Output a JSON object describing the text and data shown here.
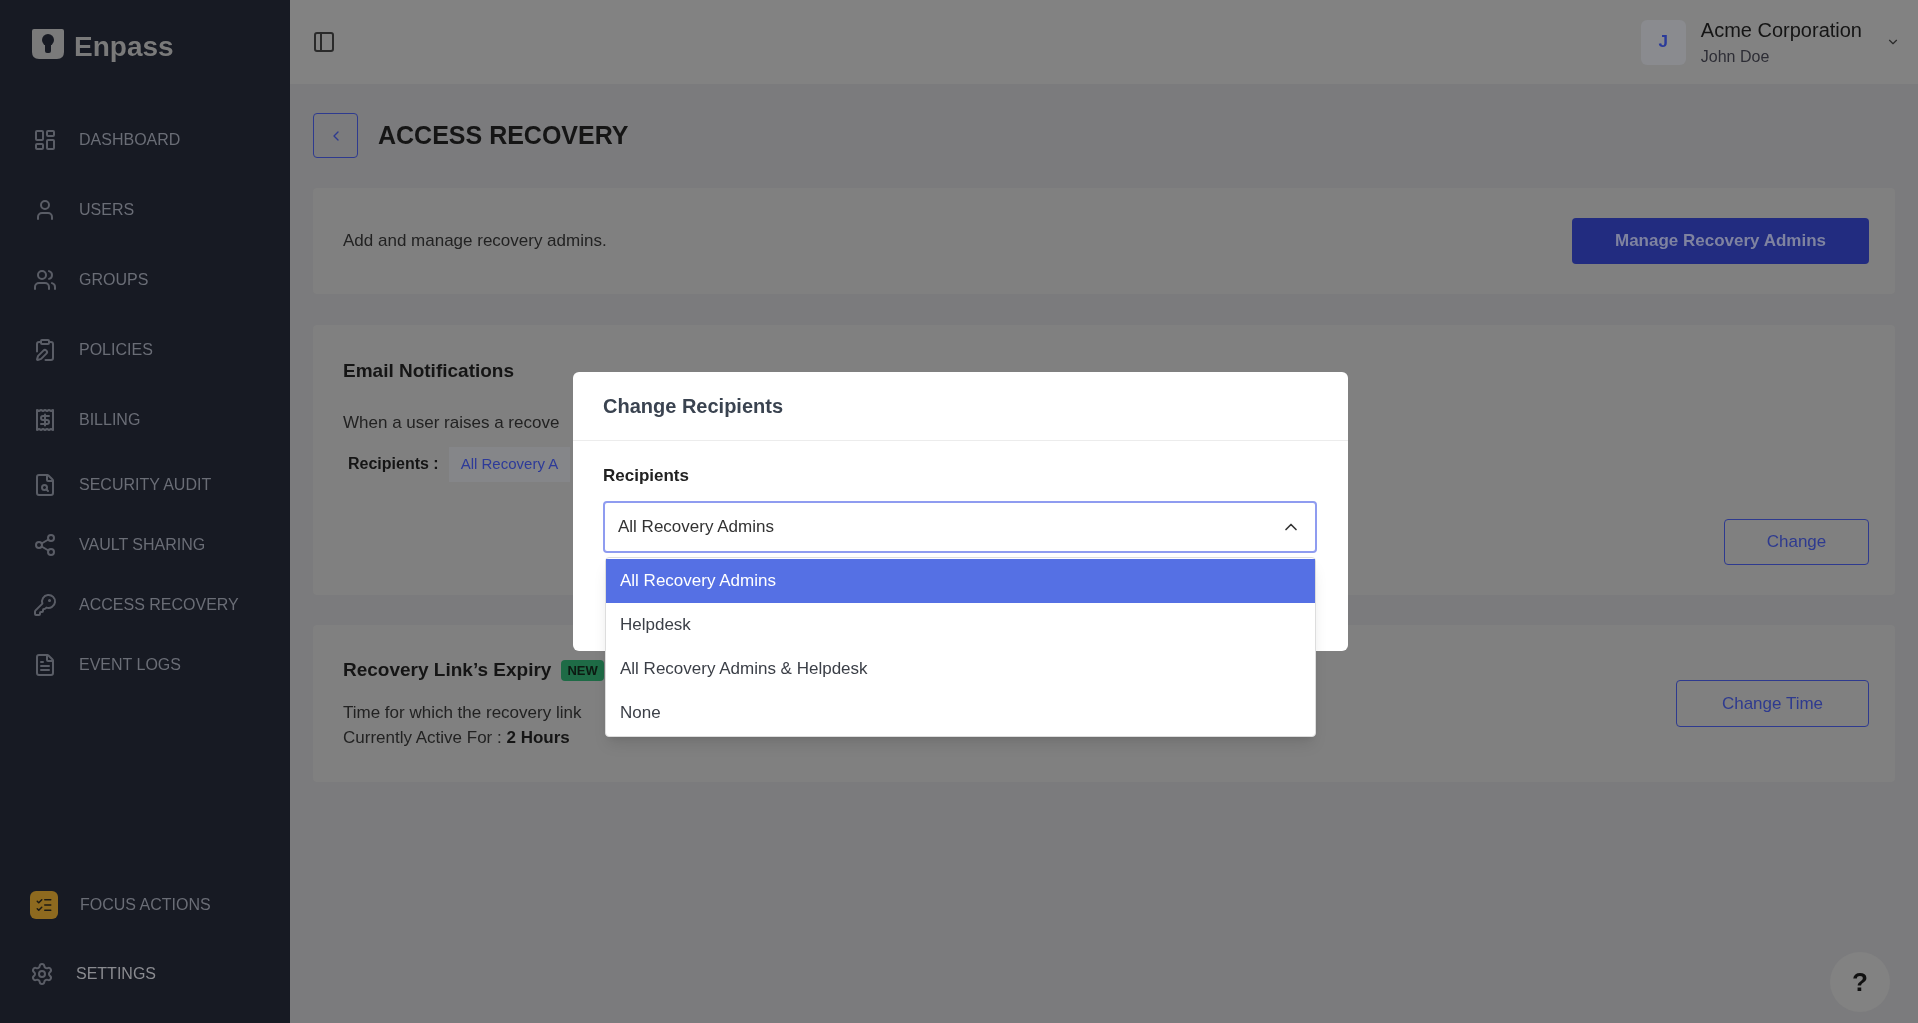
{
  "sidebar": {
    "logo": "Enpass",
    "items": [
      {
        "label": "DASHBOARD",
        "kind": "dashboard",
        "selected": false
      },
      {
        "label": "USERS",
        "kind": "user",
        "selected": false
      },
      {
        "label": "GROUPS",
        "kind": "groups",
        "selected": false
      },
      {
        "label": "POLICIES",
        "kind": "policies",
        "selected": false
      },
      {
        "label": "BILLING",
        "kind": "billing",
        "selected": false
      },
      {
        "label": "SECURITY AUDIT",
        "kind": "audit",
        "selected": false
      },
      {
        "label": "VAULT SHARING",
        "kind": "share",
        "selected": false
      },
      {
        "label": "ACCESS RECOVERY",
        "kind": "recovery",
        "selected": false
      },
      {
        "label": "EVENT LOGS",
        "kind": "logs",
        "selected": false
      }
    ],
    "bottom_items": [
      {
        "label": "FOCUS ACTIONS",
        "kind": "focus"
      },
      {
        "label": "SETTINGS",
        "kind": "settings"
      }
    ]
  },
  "header": {
    "avatar": "J",
    "organization": "Acme Corporation",
    "user": "John Doe"
  },
  "page": {
    "title": "ACCESS RECOVERY",
    "admins_card": {
      "text": "Add and manage recovery admins.",
      "button": "Manage Recovery Admins"
    },
    "email_card": {
      "title": "Email Notifications",
      "text": "When a user raises a recove",
      "recipients_label": "Recipients :",
      "recipients_value": "All Recovery A",
      "button": "Change"
    },
    "expiry_card": {
      "title": "Recovery Link’s Expiry",
      "badge": "NEW",
      "text": "Time for which the recovery link",
      "active_label": "Currently Active For :",
      "active_value": "2 Hours",
      "button": "Change Time"
    }
  },
  "help_button": "?",
  "modal": {
    "title": "Change Recipients",
    "field_label": "Recipients",
    "value": "All Recovery Admins",
    "expanded": true,
    "options": [
      {
        "label": "All Recovery Admins",
        "selected": true
      },
      {
        "label": "Helpdesk",
        "selected": false
      },
      {
        "label": "All Recovery Admins & Helpdesk",
        "selected": false
      },
      {
        "label": "None",
        "selected": false
      }
    ]
  }
}
